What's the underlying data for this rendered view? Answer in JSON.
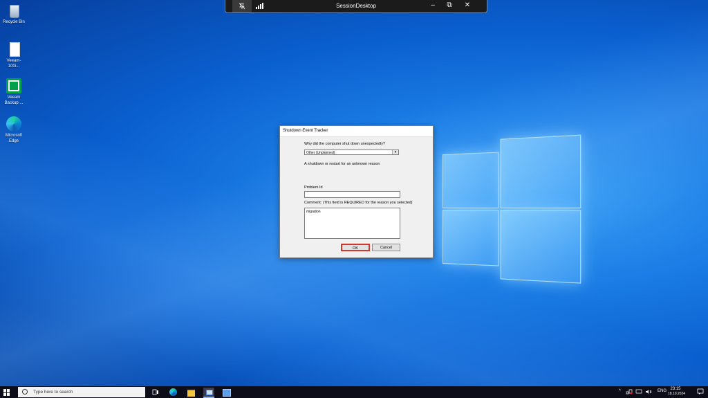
{
  "desktop": {
    "icons": [
      {
        "label": "Recycle Bin"
      },
      {
        "label": "Veeam-100i..."
      },
      {
        "label": "Veeam Backup ..."
      },
      {
        "label": "Microsoft Edge"
      }
    ]
  },
  "remote_bar": {
    "title": "SessionDesktop",
    "minimize": "–",
    "restore": "⧉",
    "close": "✕"
  },
  "dialog": {
    "title": "Shutdown Event Tracker",
    "question": "Why did the computer shut down unexpectedly?",
    "reason_selected": "Other (Unplanned)",
    "reason_description": "A shutdown or restart for an unknown reason",
    "problem_id_label": "Problem Id",
    "problem_id_value": "",
    "comment_label": "Comment: (This field is REQUIRED for the reason you selected)",
    "comment_value": "migration",
    "ok_label": "OK",
    "cancel_label": "Cancel"
  },
  "taskbar": {
    "search_placeholder": "Type here to search",
    "language": "ENG",
    "time": "23:15",
    "date": "18.10.2024"
  },
  "colors": {
    "accent_highlight": "#d9342b",
    "taskbar": "#0d0d1a"
  }
}
